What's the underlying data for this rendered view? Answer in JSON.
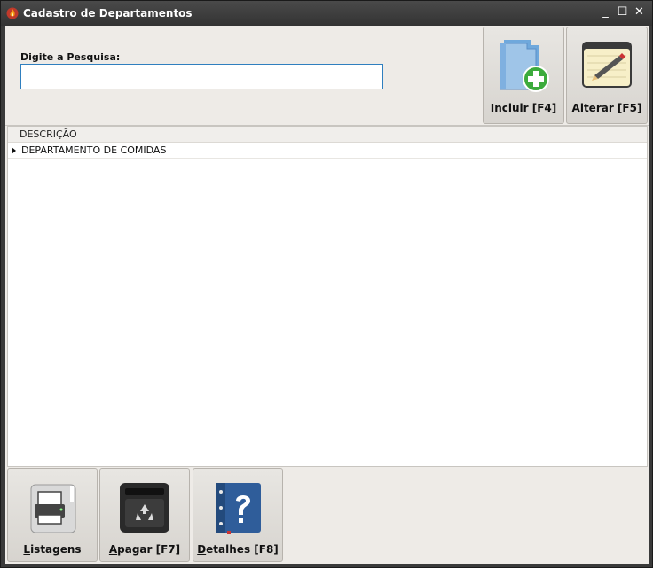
{
  "window": {
    "title": "Cadastro de Departamentos",
    "controls": {
      "minimize": "_",
      "maximize": "☐",
      "close": "✕"
    }
  },
  "search": {
    "label": "Digite a Pesquisa:",
    "value": "",
    "placeholder": ""
  },
  "toolbar": {
    "incluir": {
      "underlined": "I",
      "rest": "ncluir [F4]",
      "icon": "folder-add-icon"
    },
    "alterar": {
      "underlined": "A",
      "rest": "lterar [F5]",
      "icon": "notepad-pencil-icon"
    }
  },
  "grid": {
    "columns": [
      "DESCRIÇÃO"
    ],
    "rows": [
      {
        "descricao": "DEPARTAMENTO DE COMIDAS"
      }
    ]
  },
  "bottom": {
    "listagens": {
      "underlined": "L",
      "rest": "istagens",
      "icon": "printer-icon"
    },
    "apagar": {
      "underlined": "A",
      "rest": "pagar [F7]",
      "icon": "recycle-bin-icon"
    },
    "detalhes": {
      "underlined": "D",
      "rest": "etalhes [F8]",
      "icon": "help-book-icon"
    }
  },
  "colors": {
    "accent": "#2f7fbf",
    "panel": "#eeebe7",
    "titlebar": "#3a3a3a"
  }
}
